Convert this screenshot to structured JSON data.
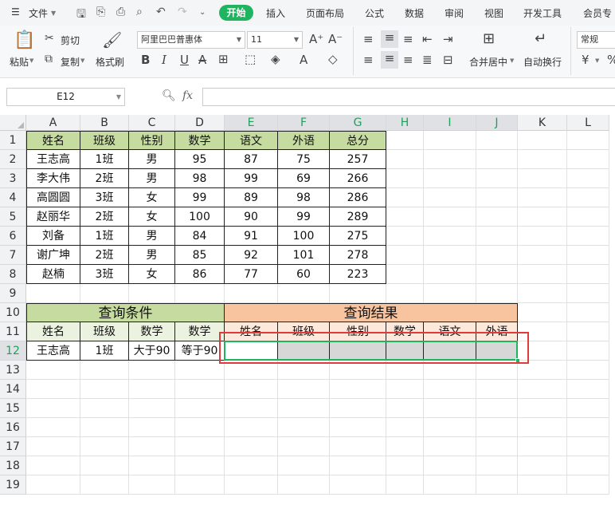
{
  "menubar": {
    "file_label": "文件",
    "tabs": [
      "开始",
      "插入",
      "页面布局",
      "公式",
      "数据",
      "审阅",
      "视图",
      "开发工具",
      "会员专"
    ],
    "active_tab": "开始"
  },
  "ribbon": {
    "paste_label": "粘贴",
    "cut_label": "剪切",
    "copy_label": "复制",
    "format_painter_label": "格式刷",
    "font_name": "阿里巴巴普惠体",
    "font_size": "11",
    "merge_label": "合并居中",
    "wrap_label": "自动换行",
    "number_format": "常规",
    "currency_symbol": "¥",
    "percent_symbol": "%"
  },
  "formula_bar": {
    "cell_ref": "E12",
    "fx_label": "fx",
    "content": ""
  },
  "sheet": {
    "columns": [
      "A",
      "B",
      "C",
      "D",
      "E",
      "F",
      "G",
      "H",
      "I",
      "J",
      "K",
      "L"
    ],
    "rows": [
      "1",
      "2",
      "3",
      "4",
      "5",
      "6",
      "7",
      "8",
      "9",
      "10",
      "11",
      "12",
      "13",
      "14",
      "15",
      "16",
      "17",
      "18",
      "19"
    ],
    "score_table": {
      "headers": [
        "姓名",
        "班级",
        "性别",
        "数学",
        "语文",
        "外语",
        "总分"
      ],
      "rows": [
        [
          "王志高",
          "1班",
          "男",
          "95",
          "87",
          "75",
          "257"
        ],
        [
          "李大伟",
          "2班",
          "男",
          "98",
          "99",
          "69",
          "266"
        ],
        [
          "高圆圆",
          "3班",
          "女",
          "99",
          "89",
          "98",
          "286"
        ],
        [
          "赵丽华",
          "2班",
          "女",
          "100",
          "90",
          "99",
          "289"
        ],
        [
          "刘备",
          "1班",
          "男",
          "84",
          "91",
          "100",
          "275"
        ],
        [
          "谢广坤",
          "2班",
          "男",
          "85",
          "92",
          "101",
          "278"
        ],
        [
          "赵楠",
          "3班",
          "女",
          "86",
          "77",
          "60",
          "223"
        ]
      ]
    },
    "query": {
      "conditions_title": "查询条件",
      "conditions_headers": [
        "姓名",
        "班级",
        "数学",
        "数学"
      ],
      "conditions_values": [
        "王志高",
        "1班",
        "大于90",
        "等于90"
      ],
      "results_title": "查询结果",
      "results_headers": [
        "姓名",
        "班级",
        "性别",
        "数学",
        "语文",
        "外语"
      ]
    }
  },
  "colors": {
    "accent": "#1fb45f",
    "header_green": "#c6dba0",
    "header_orange": "#f7c49f",
    "highlight_red": "#e03a3a"
  }
}
